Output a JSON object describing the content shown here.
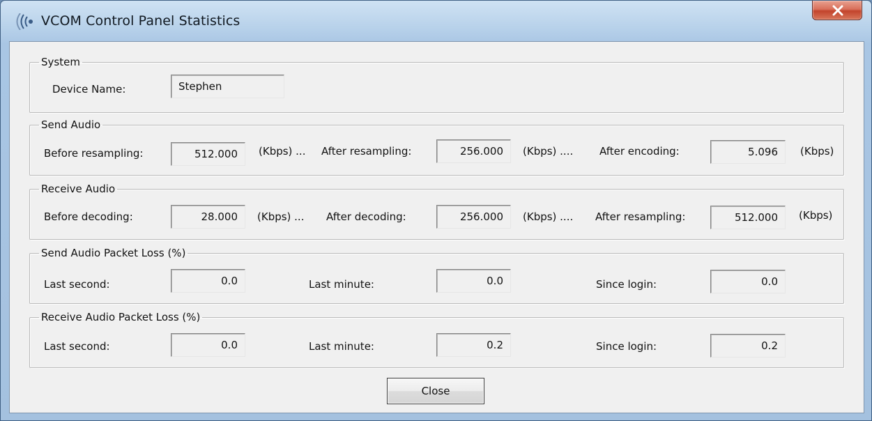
{
  "window": {
    "title": "VCOM Control Panel Statistics"
  },
  "system": {
    "legend": "System",
    "device_name_label": "Device Name:",
    "device_name_value": "Stephen"
  },
  "send_audio": {
    "legend": "Send Audio",
    "before_label": "Before resampling:",
    "before_value": "512.000",
    "unit_sep1": "(Kbps) ...",
    "after_label": "After resampling:",
    "after_value": "256.000",
    "unit_sep2": "(Kbps) ....",
    "encoding_label": "After encoding:",
    "encoding_value": "5.096",
    "unit_end": "(Kbps)"
  },
  "receive_audio": {
    "legend": "Receive Audio",
    "before_label": "Before decoding:",
    "before_value": "28.000",
    "unit_sep1": "(Kbps) ...",
    "after_label": "After decoding:",
    "after_value": "256.000",
    "unit_sep2": "(Kbps) ....",
    "resampling_label": "After resampling:",
    "resampling_value": "512.000",
    "unit_end": "(Kbps)"
  },
  "send_loss": {
    "legend": "Send Audio Packet Loss (%)",
    "last_second_label": "Last second:",
    "last_second_value": "0.0",
    "last_minute_label": "Last minute:",
    "last_minute_value": "0.0",
    "since_login_label": "Since login:",
    "since_login_value": "0.0"
  },
  "receive_loss": {
    "legend": "Receive Audio Packet Loss (%)",
    "last_second_label": "Last second:",
    "last_second_value": "0.0",
    "last_minute_label": "Last minute:",
    "last_minute_value": "0.2",
    "since_login_label": "Since login:",
    "since_login_value": "0.2"
  },
  "buttons": {
    "close_label": "Close"
  },
  "icons": {
    "app": "sound-waves-icon",
    "window_close": "close-icon"
  },
  "colors": {
    "titlebar": "#b7d1ea",
    "close_button": "#c2442c",
    "dialog_background": "#f0f0f0"
  }
}
